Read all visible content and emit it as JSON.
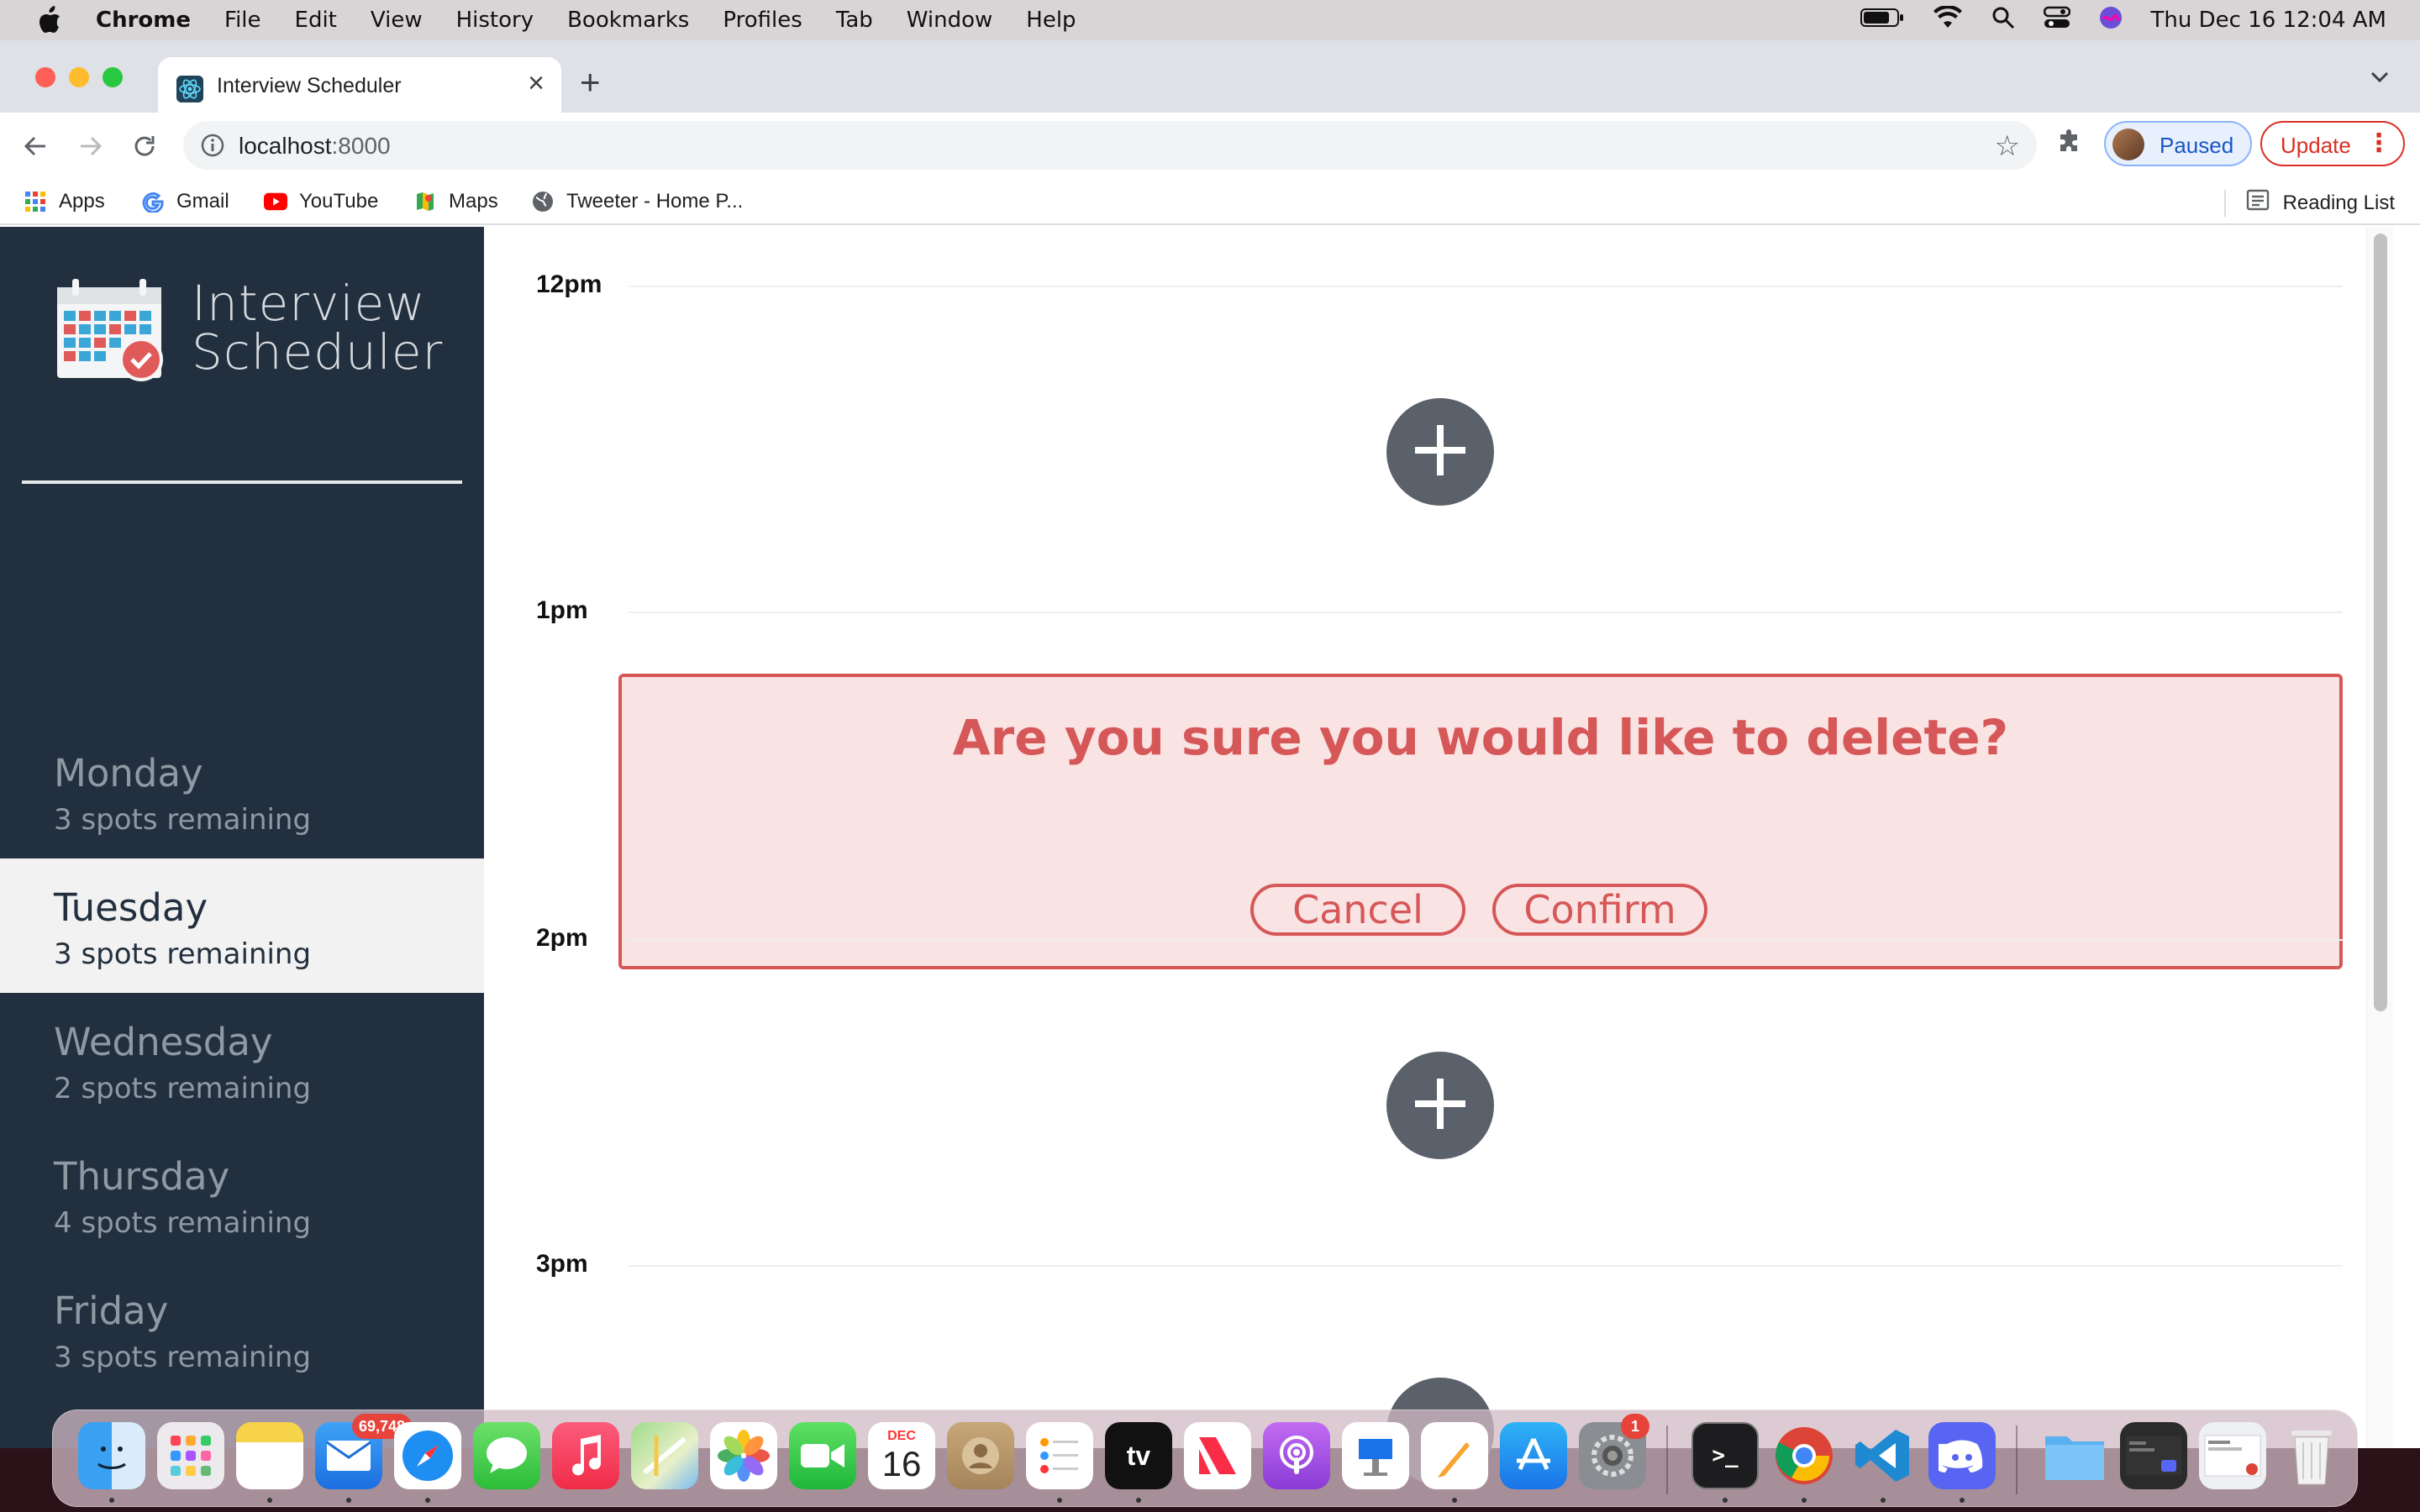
{
  "menubar": {
    "app": "Chrome",
    "items": [
      "File",
      "Edit",
      "View",
      "History",
      "Bookmarks",
      "Profiles",
      "Tab",
      "Window",
      "Help"
    ],
    "clock": "Thu Dec 16  12:04 AM"
  },
  "browser": {
    "tab_title": "Interview Scheduler",
    "url_host": "localhost",
    "url_port": ":8000",
    "profile_label": "Paused",
    "update_label": "Update",
    "bookmarks": [
      "Apps",
      "Gmail",
      "YouTube",
      "Maps",
      "Tweeter - Home P..."
    ],
    "reading_list": "Reading List"
  },
  "app": {
    "brand_line1": "Interview",
    "brand_line2": "Scheduler",
    "days": [
      {
        "name": "Monday",
        "spots": "3 spots remaining",
        "selected": false
      },
      {
        "name": "Tuesday",
        "spots": "3 spots remaining",
        "selected": true
      },
      {
        "name": "Wednesday",
        "spots": "2 spots remaining",
        "selected": false
      },
      {
        "name": "Thursday",
        "spots": "4 spots remaining",
        "selected": false
      },
      {
        "name": "Friday",
        "spots": "3 spots remaining",
        "selected": false
      }
    ],
    "slots": [
      "12pm",
      "1pm",
      "2pm",
      "3pm"
    ],
    "confirm": {
      "question": "Are you sure you would like to delete?",
      "cancel_label": "Cancel",
      "confirm_label": "Confirm"
    },
    "colors": {
      "sidebar": "#222f3e",
      "danger": "#d65758",
      "danger_bg": "#f9e3e3",
      "add_button": "#5b616a"
    }
  },
  "dock": {
    "mail_badge": "69,748",
    "calendar_month": "DEC",
    "calendar_day": "16",
    "settings_badge": "1",
    "apps": [
      "finder",
      "launchpad",
      "notes",
      "mail",
      "safari",
      "messages",
      "music",
      "maps",
      "photos",
      "facetime",
      "calendar",
      "contacts",
      "reminders",
      "apple-tv",
      "news",
      "podcasts",
      "keynote",
      "pages",
      "app-store",
      "system-preferences",
      "terminal",
      "chrome",
      "vscode",
      "discord",
      "downloads-folder",
      "recent-window",
      "screenshot-stack",
      "trash"
    ]
  }
}
